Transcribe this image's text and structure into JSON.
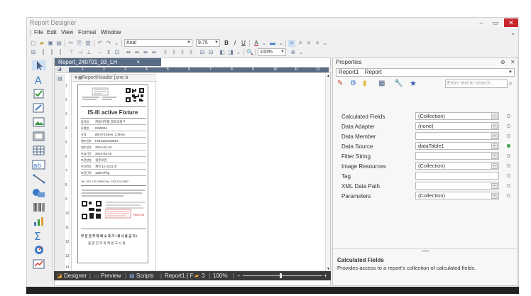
{
  "window": {
    "title": "Report Designer"
  },
  "window_controls": {
    "minimize": "–",
    "maximize": "▭",
    "close": "✕"
  },
  "menu": [
    "File",
    "Edit",
    "View",
    "Format",
    "Window"
  ],
  "toolbar": {
    "font_name": "Arial",
    "font_size": "9.75",
    "bold": "B",
    "italic": "I",
    "underline": "U",
    "font_color": "A",
    "zoom": "100%"
  },
  "document": {
    "tab_label": "Report_240701_03_LH",
    "tab_close": "×",
    "band_label": "ReportHeader [one b",
    "hruler_ticks": [
      "1",
      "2",
      "3",
      "4",
      "5",
      "6",
      "7",
      "8",
      "9",
      "10",
      "11",
      "12"
    ],
    "vruler_ticks": [
      "1",
      "2",
      "3",
      "4",
      "5",
      "6",
      "7",
      "8",
      "9",
      "10",
      "11",
      "12",
      "13",
      "14"
    ],
    "label": {
      "title": "IS-III active Fixture",
      "rows": [
        {
          "k": "품목명",
          "v": "자동차부품 흡착고정구"
        },
        {
          "k": "모델명",
          "v": "IS5500A"
        },
        {
          "k": "규격",
          "v": "Ø5.5*3.5mm, 2.5Hex"
        },
        {
          "k": "제조번호",
          "v": "F010124040657"
        },
        {
          "k": "제조일자",
          "v": "2024-02-19"
        },
        {
          "k": "유효기간",
          "v": "2024-03-19"
        },
        {
          "k": "보관방법",
          "v": "실온보관"
        },
        {
          "k": "허가번호",
          "v": "제인 11-1011 호"
        },
        {
          "k": "포장단위",
          "v": "1SET/Pkg"
        }
      ],
      "contact": "Tel. 033-742-2880    Fax. 033-742-2887",
      "lot_label": "REV.02",
      "footer_line1": "부 전 전 부 파 에 소 과 기 / 세 사 용 금 지 /",
      "footer_line2": "물 원 전 조 회 확 원 교 시 방"
    }
  },
  "status_bar": {
    "designer": "Designer",
    "preview": "Preview",
    "scripts": "Scripts",
    "report_name": "Report1 { F",
    "band_count": "3",
    "zoom": "100%"
  },
  "properties": {
    "header": "Properties",
    "pin": "⊕",
    "close": "✕",
    "selected_object": "Report1",
    "selected_type": "Report",
    "search_placeholder": "Enter text to search...",
    "rows": [
      {
        "name": "Calculated Fields",
        "value": "(Collection)",
        "button": "…",
        "active": false
      },
      {
        "name": "Data Adapter",
        "value": "(none)",
        "button": "⌄",
        "active": false
      },
      {
        "name": "Data Member",
        "value": "",
        "button": "⌄",
        "active": false
      },
      {
        "name": "Data Source",
        "value": "dataTable1",
        "button": "⌄",
        "active": true
      },
      {
        "name": "Filter String",
        "value": "",
        "button": "…",
        "active": false
      },
      {
        "name": "Image Resources",
        "value": "(Collection)",
        "button": "…",
        "active": false
      },
      {
        "name": "Tag",
        "value": "",
        "button": "",
        "active": false
      },
      {
        "name": "XML Data Path",
        "value": "",
        "button": "…",
        "active": false
      },
      {
        "name": "Parameters",
        "value": "(Collection)",
        "button": "…",
        "active": false
      }
    ],
    "description_title": "Calculated Fields",
    "description_text": "Provides access to a report's collection of calculated fields."
  },
  "colors": {
    "accent": "#5a6d87",
    "close_button": "#c8262b",
    "status_bar": "#3b3b3b",
    "data_bound_dot": "#4caf50"
  },
  "icons": [
    "pointer-icon",
    "label-icon",
    "checkbox-icon",
    "richtext-icon",
    "picture-icon",
    "panel-icon",
    "table-icon",
    "character-comb-icon",
    "line-icon",
    "shape-icon",
    "barcode-icon",
    "chart-icon",
    "sparkline-icon",
    "gauge-icon",
    "subreport-icon"
  ]
}
